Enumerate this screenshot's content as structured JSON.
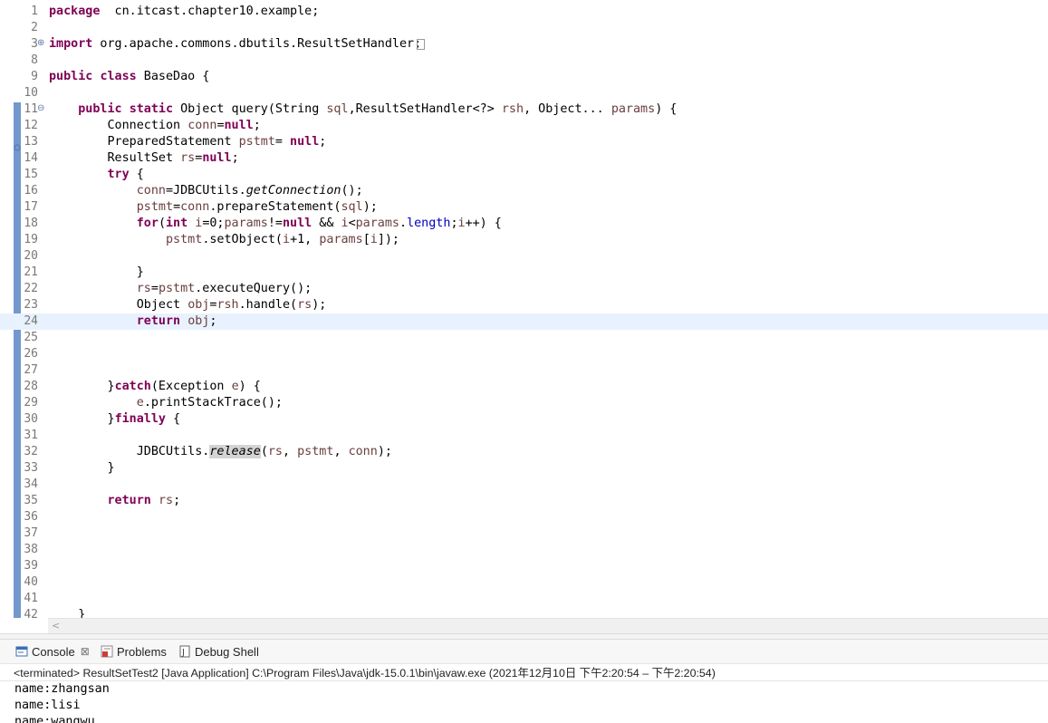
{
  "editor": {
    "lines": [
      {
        "n": "1",
        "t": [
          [
            "kw",
            "package"
          ],
          [
            "",
            "  cn.itcast.chapter10.example;"
          ]
        ]
      },
      {
        "n": "2",
        "t": []
      },
      {
        "n": "3",
        "fold": "⊕",
        "t": [
          [
            "kw",
            "import"
          ],
          [
            "",
            " org.apache.commons.dbutils.ResultSetHandler;"
          ]
        ]
      },
      {
        "n": "8",
        "t": []
      },
      {
        "n": "9",
        "t": [
          [
            "kw",
            "public"
          ],
          [
            "",
            " "
          ],
          [
            "kw",
            "class"
          ],
          [
            "",
            " BaseDao {"
          ]
        ]
      },
      {
        "n": "10",
        "t": []
      },
      {
        "n": "11",
        "fold": "⊖",
        "t": [
          [
            "",
            "    "
          ],
          [
            "kw",
            "public"
          ],
          [
            "",
            " "
          ],
          [
            "kw",
            "static"
          ],
          [
            "",
            " Object query(String "
          ],
          [
            "var",
            "sql"
          ],
          [
            "",
            ",ResultSetHandler<?> "
          ],
          [
            "var",
            "rsh"
          ],
          [
            "",
            ", Object... "
          ],
          [
            "var",
            "params"
          ],
          [
            "",
            ") {"
          ]
        ]
      },
      {
        "n": "12",
        "t": [
          [
            "",
            "        Connection "
          ],
          [
            "var",
            "conn"
          ],
          [
            "",
            "="
          ],
          [
            "kw",
            "null"
          ],
          [
            "",
            ";"
          ]
        ]
      },
      {
        "n": "13",
        "t": [
          [
            "",
            "        PreparedStatement "
          ],
          [
            "var",
            "pstmt"
          ],
          [
            "",
            "= "
          ],
          [
            "kw",
            "null"
          ],
          [
            "",
            ";"
          ]
        ]
      },
      {
        "n": "14",
        "t": [
          [
            "",
            "        ResultSet "
          ],
          [
            "var",
            "rs"
          ],
          [
            "",
            "="
          ],
          [
            "kw",
            "null"
          ],
          [
            "",
            ";"
          ]
        ]
      },
      {
        "n": "15",
        "t": [
          [
            "",
            "        "
          ],
          [
            "kw",
            "try"
          ],
          [
            "",
            " {"
          ]
        ]
      },
      {
        "n": "16",
        "t": [
          [
            "",
            "            "
          ],
          [
            "var",
            "conn"
          ],
          [
            "",
            "=JDBCUtils."
          ],
          [
            "it",
            "getConnection"
          ],
          [
            "",
            "();"
          ]
        ]
      },
      {
        "n": "17",
        "t": [
          [
            "",
            "            "
          ],
          [
            "var",
            "pstmt"
          ],
          [
            "",
            "="
          ],
          [
            "var",
            "conn"
          ],
          [
            "",
            ".prepareStatement("
          ],
          [
            "var",
            "sql"
          ],
          [
            "",
            ");"
          ]
        ]
      },
      {
        "n": "18",
        "t": [
          [
            "",
            "            "
          ],
          [
            "kw",
            "for"
          ],
          [
            "",
            "("
          ],
          [
            "kw",
            "int"
          ],
          [
            "",
            " "
          ],
          [
            "var",
            "i"
          ],
          [
            "",
            "=0;"
          ],
          [
            "var",
            "params"
          ],
          [
            "",
            "!="
          ],
          [
            "kw",
            "null"
          ],
          [
            "",
            " && "
          ],
          [
            "var",
            "i"
          ],
          [
            "",
            "<"
          ],
          [
            "var",
            "params"
          ],
          [
            "",
            "."
          ],
          [
            "fld",
            "length"
          ],
          [
            "",
            ";"
          ],
          [
            "var",
            "i"
          ],
          [
            "",
            "++) {"
          ]
        ]
      },
      {
        "n": "19",
        "t": [
          [
            "",
            "                "
          ],
          [
            "var",
            "pstmt"
          ],
          [
            "",
            ".setObject("
          ],
          [
            "var",
            "i"
          ],
          [
            "",
            "+1, "
          ],
          [
            "var",
            "params"
          ],
          [
            "",
            "["
          ],
          [
            "var",
            "i"
          ],
          [
            "",
            "]);"
          ]
        ]
      },
      {
        "n": "20",
        "t": []
      },
      {
        "n": "21",
        "t": [
          [
            "",
            "            }"
          ]
        ]
      },
      {
        "n": "22",
        "t": [
          [
            "",
            "            "
          ],
          [
            "var",
            "rs"
          ],
          [
            "",
            "="
          ],
          [
            "var",
            "pstmt"
          ],
          [
            "",
            ".executeQuery();"
          ]
        ]
      },
      {
        "n": "23",
        "t": [
          [
            "",
            "            Object "
          ],
          [
            "var",
            "obj"
          ],
          [
            "",
            "="
          ],
          [
            "var",
            "rsh"
          ],
          [
            "",
            ".handle("
          ],
          [
            "var",
            "rs"
          ],
          [
            "",
            ");"
          ]
        ]
      },
      {
        "n": "24",
        "current": true,
        "t": [
          [
            "",
            "            "
          ],
          [
            "kw",
            "return"
          ],
          [
            "",
            " "
          ],
          [
            "var",
            "obj"
          ],
          [
            "",
            ";"
          ]
        ]
      },
      {
        "n": "25",
        "t": []
      },
      {
        "n": "26",
        "t": []
      },
      {
        "n": "27",
        "t": []
      },
      {
        "n": "28",
        "t": [
          [
            "",
            "        }"
          ],
          [
            "kw",
            "catch"
          ],
          [
            "",
            "(Exception "
          ],
          [
            "var",
            "e"
          ],
          [
            "",
            ") {"
          ]
        ]
      },
      {
        "n": "29",
        "t": [
          [
            "",
            "            "
          ],
          [
            "var",
            "e"
          ],
          [
            "",
            ".printStackTrace();"
          ]
        ]
      },
      {
        "n": "30",
        "t": [
          [
            "",
            "        }"
          ],
          [
            "kw",
            "finally"
          ],
          [
            "",
            " {"
          ]
        ]
      },
      {
        "n": "31",
        "t": []
      },
      {
        "n": "32",
        "t": [
          [
            "",
            "            JDBCUtils."
          ],
          [
            "it hl",
            "release"
          ],
          [
            "",
            "("
          ],
          [
            "var",
            "rs"
          ],
          [
            "",
            ", "
          ],
          [
            "var",
            "pstmt"
          ],
          [
            "",
            ", "
          ],
          [
            "var",
            "conn"
          ],
          [
            "",
            ");"
          ]
        ]
      },
      {
        "n": "33",
        "t": [
          [
            "",
            "        }"
          ]
        ]
      },
      {
        "n": "34",
        "t": []
      },
      {
        "n": "35",
        "t": [
          [
            "",
            "        "
          ],
          [
            "kw",
            "return"
          ],
          [
            "",
            " "
          ],
          [
            "var",
            "rs"
          ],
          [
            "",
            ";"
          ]
        ]
      },
      {
        "n": "36",
        "t": []
      },
      {
        "n": "37",
        "t": []
      },
      {
        "n": "38",
        "t": []
      },
      {
        "n": "39",
        "t": []
      },
      {
        "n": "40",
        "t": []
      },
      {
        "n": "41",
        "t": []
      },
      {
        "n": "42",
        "t": [
          [
            "",
            "    }"
          ]
        ]
      }
    ]
  },
  "console": {
    "tabs": [
      {
        "label": "Console",
        "icon": "console-icon"
      },
      {
        "label": "Problems",
        "icon": "problems-icon"
      },
      {
        "label": "Debug Shell",
        "icon": "debug-shell-icon"
      }
    ],
    "close_glyph": "⊠",
    "status": "<terminated> ResultSetTest2 [Java Application] C:\\Program Files\\Java\\jdk-15.0.1\\bin\\javaw.exe  (2021年12月10日 下午2:20:54 – 下午2:20:54)",
    "output": [
      "name:zhangsan",
      "name:lisi",
      "name:wangwu"
    ]
  },
  "colors": {
    "keyword": "#7f0055",
    "local_variable": "#6a3e3e",
    "field": "#0000c0",
    "current_line": "#e8f2fe",
    "ruler": "#5a86c4"
  }
}
